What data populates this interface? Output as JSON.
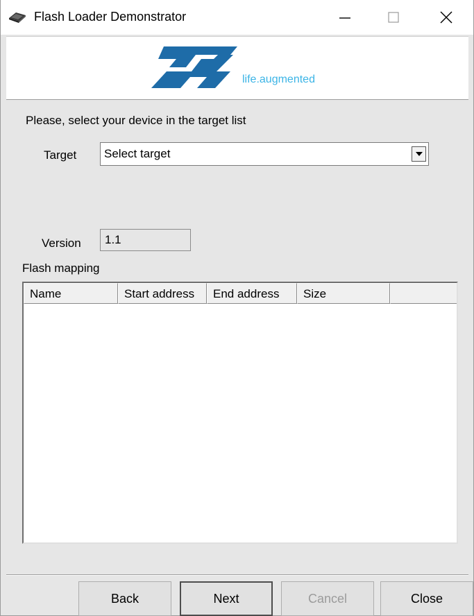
{
  "window": {
    "title": "Flash Loader Demonstrator",
    "icons": [
      "app-chip-icon",
      "minimize-icon",
      "maximize-icon",
      "close-icon"
    ]
  },
  "banner": {
    "logo": "st-logo",
    "tagline": "life.augmented",
    "colors": {
      "logo": "#1e6ca8",
      "tagline": "#3bb4e6"
    }
  },
  "form": {
    "instruction": "Please, select your device in the target list",
    "target_label": "Target",
    "target_value": "Select target",
    "version_label": "Version",
    "version_value": "1.1",
    "mapping_label": "Flash mapping"
  },
  "table": {
    "columns": [
      "Name",
      "Start address",
      "End address",
      "Size",
      ""
    ],
    "rows": []
  },
  "buttons": {
    "back": "Back",
    "next": "Next",
    "cancel": "Cancel",
    "close": "Close"
  }
}
